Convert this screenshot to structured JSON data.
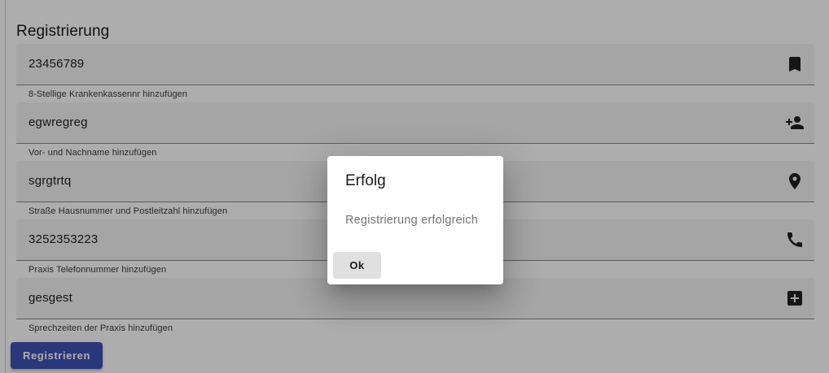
{
  "form": {
    "title": "Registrierung",
    "fields": [
      {
        "value": "23456789",
        "hint": "8-Stellige Krankenkassennr hinzufügen",
        "icon": "bookmark-icon"
      },
      {
        "value": "egwregreg",
        "hint": "Vor- und Nachname hinzufügen",
        "icon": "person-add-icon"
      },
      {
        "value": "sgrgtrtq",
        "hint": "Straße Hausnummer und Postleitzahl hinzufügen",
        "icon": "location-pin-icon"
      },
      {
        "value": "3252353223",
        "hint": "Praxis Telefonnummer hinzufügen",
        "icon": "phone-icon"
      },
      {
        "value": "gesgest",
        "hint": "Sprechzeiten der Praxis hinzufügen",
        "icon": "medical-cross-icon"
      }
    ],
    "submit_label": "Registrieren"
  },
  "dialog": {
    "title": "Erfolg",
    "message": "Registrierung erfolgreich",
    "ok_label": "Ok"
  },
  "colors": {
    "primary": "#3f51b5",
    "field_background": "#f3f3f3",
    "backdrop": "rgba(0,0,0,0.32)",
    "icon": "#212121"
  }
}
